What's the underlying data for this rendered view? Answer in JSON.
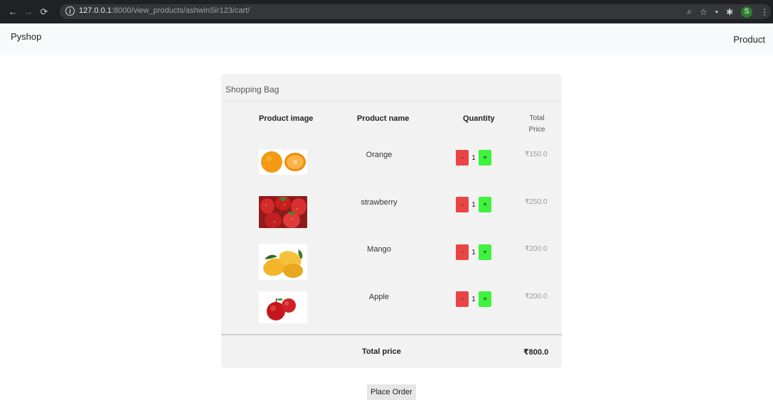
{
  "browser": {
    "url_host": "127.0.0.1",
    "url_rest": ":8000/view_products/ashwinSir123/cart/",
    "profile_initial": "S",
    "icons": [
      "back-arrow-icon",
      "forward-arrow-icon",
      "reload-icon",
      "info-icon",
      "zoom-icon",
      "star-icon",
      "extension-icon",
      "puzzle-icon",
      "profile-avatar",
      "menu-dots-icon"
    ]
  },
  "navbar": {
    "brand": "Pyshop",
    "link": "Product"
  },
  "cart": {
    "title": "Shopping Bag",
    "headers": {
      "image": "Product image",
      "name": "Product name",
      "quantity": "Quantity",
      "total_line1": "Total",
      "total_line2": "Price"
    },
    "items": [
      {
        "name": "Orange",
        "qty": "1",
        "price": "₹150.0",
        "minus": "-",
        "plus": "+"
      },
      {
        "name": "strawberry",
        "qty": "1",
        "price": "₹250.0",
        "minus": "-",
        "plus": "+"
      },
      {
        "name": "Mango",
        "qty": "1",
        "price": "₹200.0",
        "minus": "-",
        "plus": "+"
      },
      {
        "name": "Apple",
        "qty": "1",
        "price": "₹200.0",
        "minus": "-",
        "plus": "+"
      }
    ],
    "footer_label": "Total price",
    "footer_total": "₹800.0"
  },
  "actions": {
    "place_order": "Place Order"
  },
  "colors": {
    "minus_button": "#e94545",
    "plus_button": "#3ef23e",
    "card_background": "#f2f2f2",
    "navbar_background": "#f8f9fa"
  }
}
